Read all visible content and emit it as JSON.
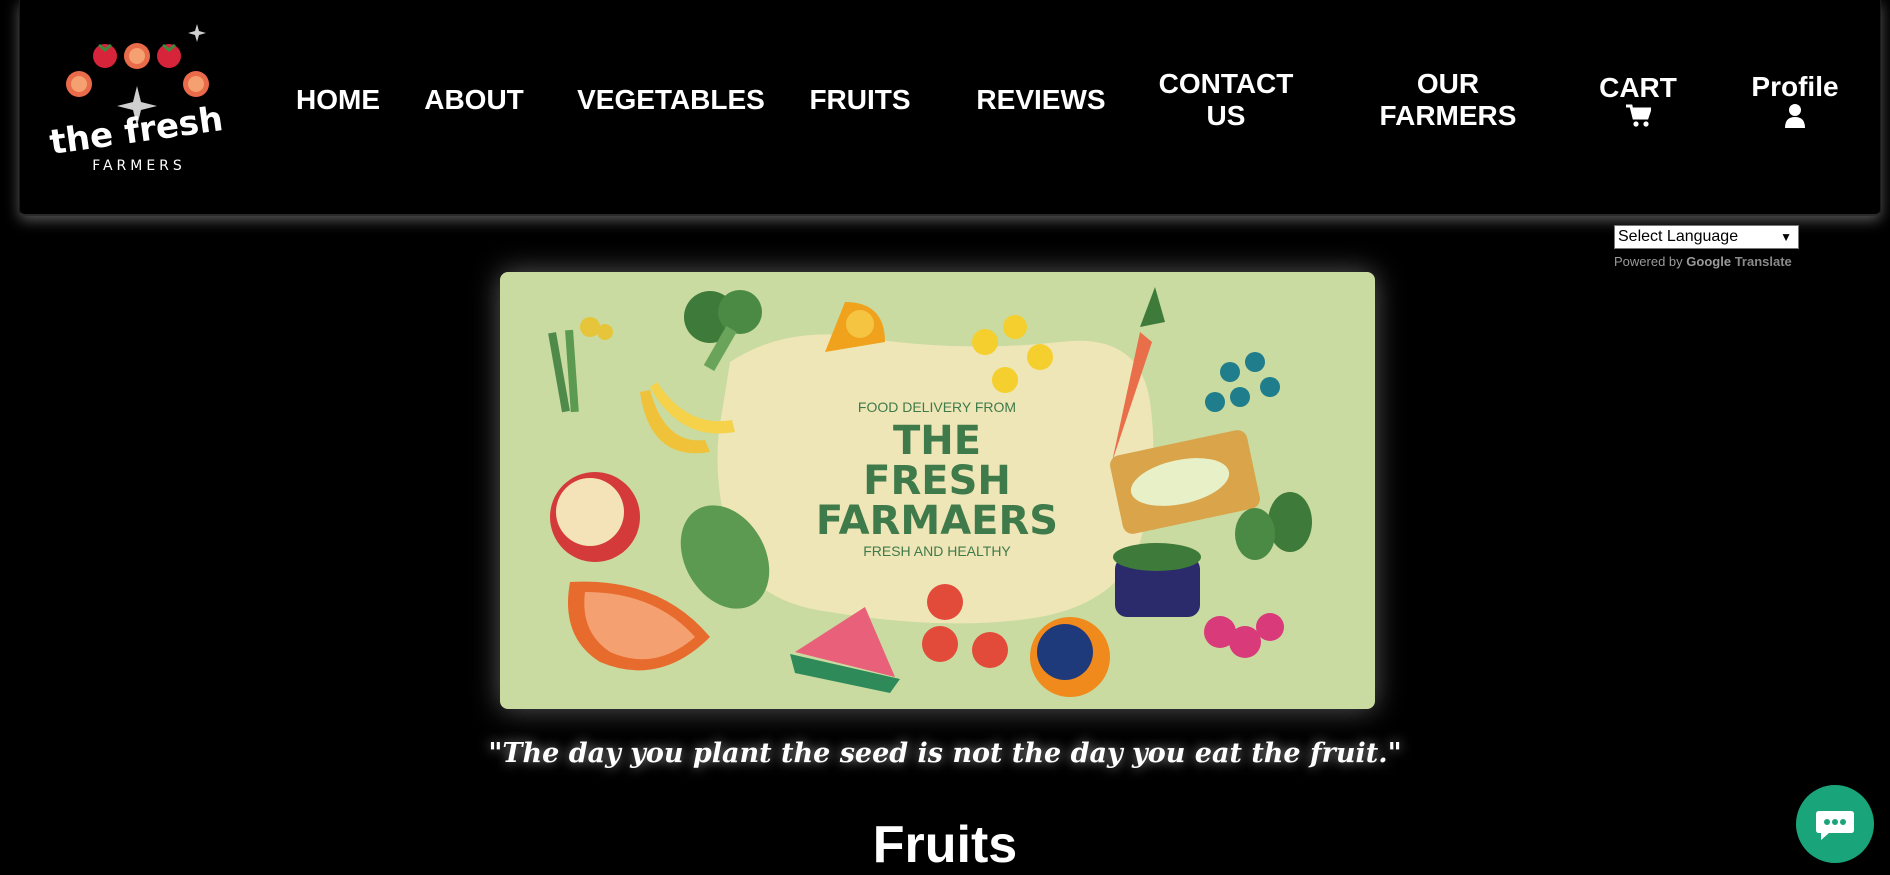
{
  "brand": {
    "logo_line1": "the fresh",
    "logo_line2": "FARMERS"
  },
  "nav": {
    "home": "HOME",
    "about": "ABOUT",
    "vegetables": "VEGETABLES",
    "fruits": "FRUITS",
    "reviews": "REVIEWS",
    "contact_line1": "CONTACT",
    "contact_line2": "US",
    "farmers_line1": "OUR",
    "farmers_line2": "FARMERS",
    "cart": "CART",
    "cart_icon": "shopping-cart-icon",
    "profile": "Profile",
    "profile_icon": "user-icon"
  },
  "translate": {
    "select_label": "Select Language",
    "powered_by": "Powered by",
    "google": "Google",
    "translate": "Translate"
  },
  "banner": {
    "line1": "FOOD DELIVERY FROM",
    "line2": "THE",
    "line3": "FRESH",
    "line4": "FARMAERS",
    "line5": "FRESH AND HEALTHY"
  },
  "quote": "\"The day you plant the seed is not the day you eat the fruit.\"",
  "section_title": "Fruits",
  "colors": {
    "background": "#000000",
    "banner_bg": "#c9dba0",
    "banner_blob": "#efe6b8",
    "banner_text": "#3f7a4a",
    "chat_button": "#1aa47a"
  }
}
